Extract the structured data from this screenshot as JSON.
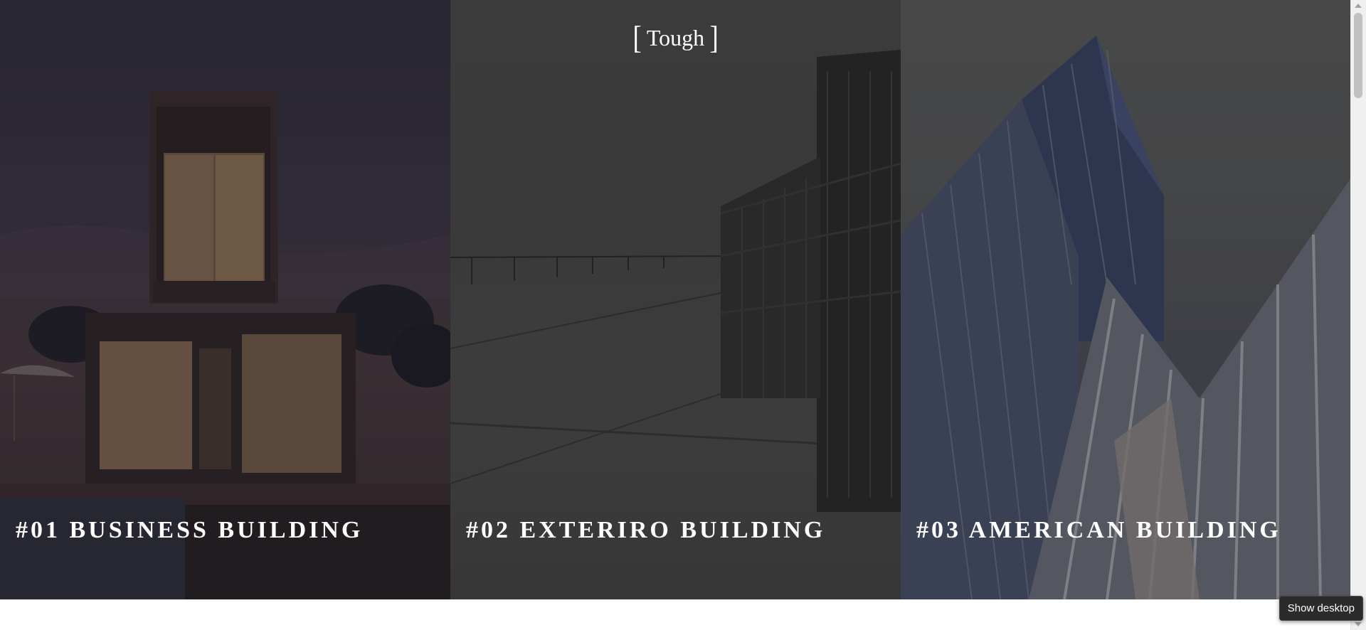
{
  "logo": {
    "open_bracket": "[",
    "text": "Tough",
    "close_bracket": "]"
  },
  "panels": [
    {
      "title": "#01 BUSINESS BUILDING",
      "image": "modern-house-night-image"
    },
    {
      "title": "#02 EXTERIRO BUILDING",
      "image": "gray-building-exterior-image"
    },
    {
      "title": "#03 AMERICAN BUILDING",
      "image": "glass-skyscraper-image"
    }
  ],
  "tooltip": {
    "label": "Show desktop"
  },
  "colors": {
    "title_text": "#ffffff",
    "page_background": "#ffffff",
    "tooltip_background": "#2b2b2b"
  }
}
